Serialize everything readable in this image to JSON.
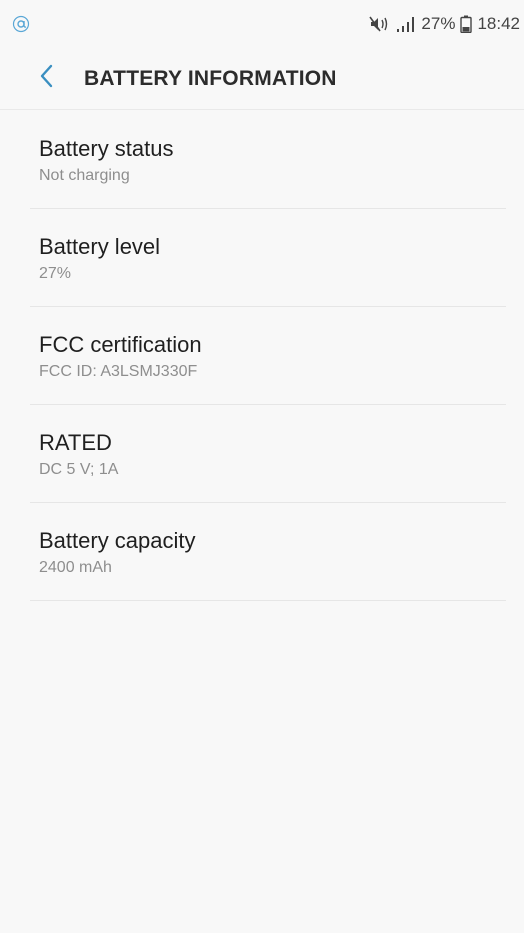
{
  "status_bar": {
    "notification_icon": "at-sign-icon",
    "icons": [
      "mute-icon",
      "signal-icon",
      "battery-icon"
    ],
    "battery_percent": "27%",
    "time": "18:42"
  },
  "header": {
    "back_icon": "chevron-left-icon",
    "title": "BATTERY INFORMATION",
    "accent_color": "#3a8fc1"
  },
  "items": [
    {
      "title": "Battery status",
      "value": "Not charging"
    },
    {
      "title": "Battery level",
      "value": "27%"
    },
    {
      "title": "FCC certification",
      "value": "FCC ID: A3LSMJ330F"
    },
    {
      "title": "RATED",
      "value": "DC 5 V; 1A"
    },
    {
      "title": "Battery capacity",
      "value": "2400 mAh"
    }
  ]
}
